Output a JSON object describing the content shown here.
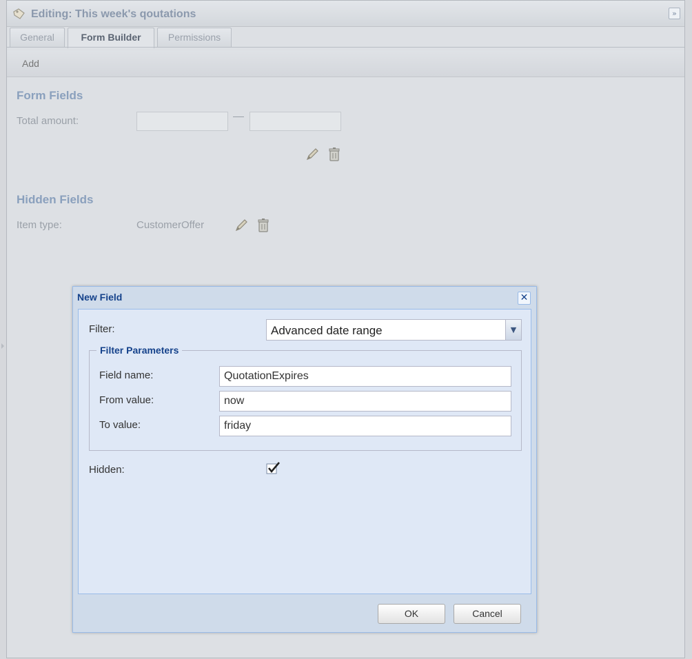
{
  "panel": {
    "title": "Editing: This week's qoutations",
    "title_icon": "tag-icon",
    "collapse_icon": "double-chevron-right-icon"
  },
  "tabs": [
    {
      "label": "General",
      "active": false
    },
    {
      "label": "Form Builder",
      "active": true
    },
    {
      "label": "Permissions",
      "active": false
    }
  ],
  "toolbar": {
    "add_label": "Add"
  },
  "form_fields": {
    "title": "Form Fields",
    "rows": [
      {
        "label": "Total amount:",
        "from_value": "",
        "to_value": "",
        "edit_icon": "pencil-icon",
        "delete_icon": "trash-icon"
      }
    ]
  },
  "hidden_fields": {
    "title": "Hidden Fields",
    "rows": [
      {
        "label": "Item type:",
        "value": "CustomerOffer",
        "edit_icon": "pencil-icon",
        "delete_icon": "trash-icon"
      }
    ]
  },
  "dialog": {
    "title": "New Field",
    "close_icon": "close-icon",
    "filter_label": "Filter:",
    "filter_value": "Advanced date range",
    "params_legend": "Filter Parameters",
    "field_name_label": "Field name:",
    "field_name_value": "QuotationExpires",
    "from_label": "From value:",
    "from_value": "now",
    "to_label": "To value:",
    "to_value": "friday",
    "hidden_label": "Hidden:",
    "hidden_checked": true,
    "ok_label": "OK",
    "cancel_label": "Cancel"
  },
  "colors": {
    "dialog_title": "#15428b",
    "section_title": "#8aa0bd",
    "dialog_border": "#99bbe8"
  }
}
